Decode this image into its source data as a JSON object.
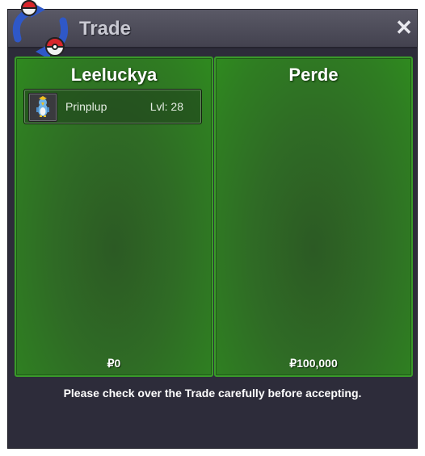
{
  "window": {
    "title": "Trade",
    "close_symbol": "✕",
    "accent": "#3a9a2a"
  },
  "left_panel": {
    "trader": "Leeluckya",
    "items": [
      {
        "name": "Prinplup",
        "level": "Lvl: 28",
        "icon": "prinplup-sprite-icon"
      }
    ],
    "money": "₽0"
  },
  "right_panel": {
    "trader": "Perde",
    "items": [],
    "money": "₽100,000"
  },
  "footer": {
    "notice": "Please check over the Trade carefully before accepting."
  }
}
